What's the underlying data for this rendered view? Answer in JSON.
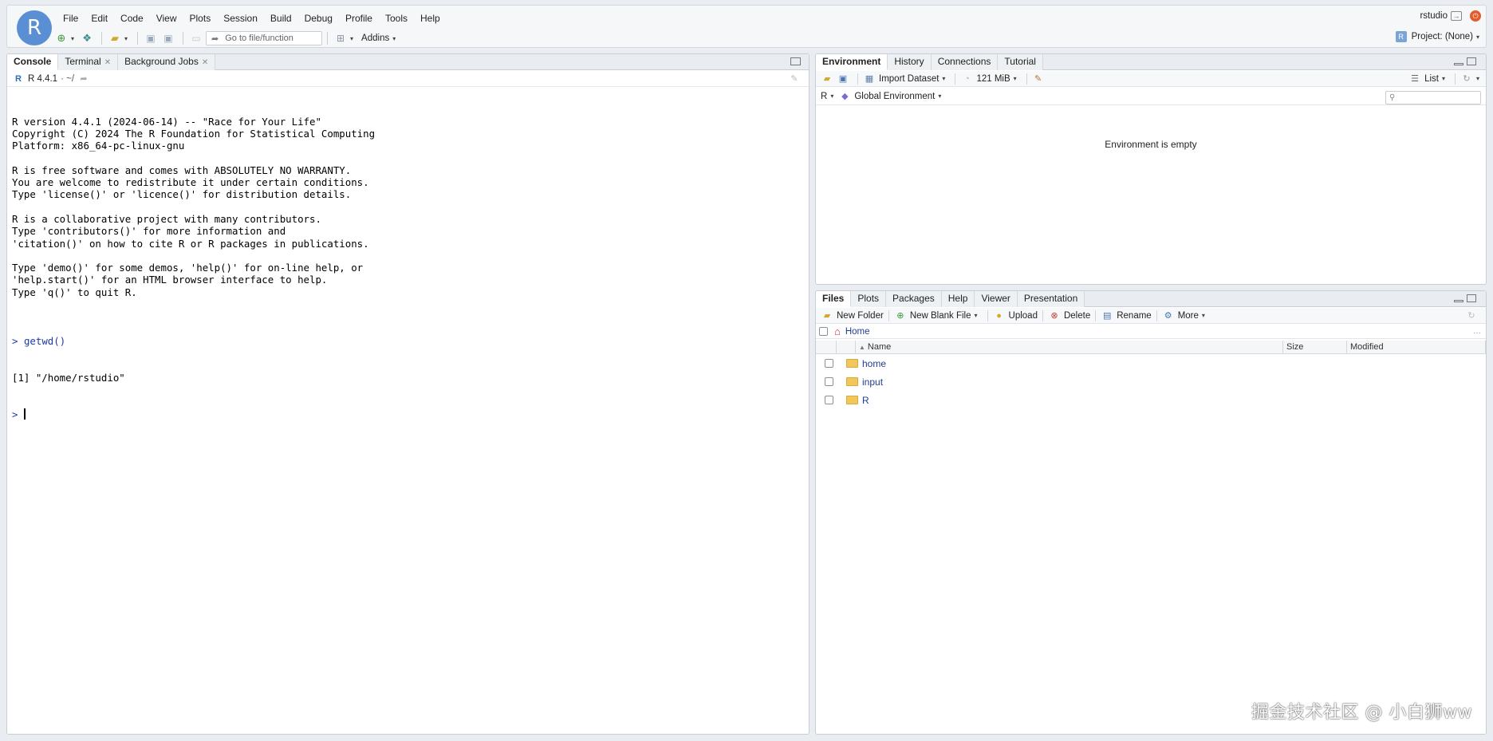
{
  "header": {
    "logo_letter": "R",
    "menu": [
      "File",
      "Edit",
      "Code",
      "View",
      "Plots",
      "Session",
      "Build",
      "Debug",
      "Profile",
      "Tools",
      "Help"
    ],
    "goto_placeholder": "Go to file/function",
    "addins_label": "Addins",
    "user": "rstudio",
    "project_label": "Project: (None)"
  },
  "console_pane": {
    "tabs": [
      {
        "label": "Console",
        "active": true,
        "closable": false
      },
      {
        "label": "Terminal",
        "active": false,
        "closable": true
      },
      {
        "label": "Background Jobs",
        "active": false,
        "closable": true
      }
    ],
    "r_version_label": "R 4.4.1",
    "working_dir": "· ~/",
    "startup_lines": [
      "R version 4.4.1 (2024-06-14) -- \"Race for Your Life\"",
      "Copyright (C) 2024 The R Foundation for Statistical Computing",
      "Platform: x86_64-pc-linux-gnu",
      "",
      "R is free software and comes with ABSOLUTELY NO WARRANTY.",
      "You are welcome to redistribute it under certain conditions.",
      "Type 'license()' or 'licence()' for distribution details.",
      "",
      "R is a collaborative project with many contributors.",
      "Type 'contributors()' for more information and",
      "'citation()' on how to cite R or R packages in publications.",
      "",
      "Type 'demo()' for some demos, 'help()' for on-line help, or",
      "'help.start()' for an HTML browser interface to help.",
      "Type 'q()' to quit R.",
      ""
    ],
    "command_prompt": ">",
    "command": "getwd()",
    "command_output": "[1] \"/home/rstudio\"",
    "input_prompt": ">"
  },
  "env_pane": {
    "tabs": [
      {
        "label": "Environment",
        "active": true
      },
      {
        "label": "History",
        "active": false
      },
      {
        "label": "Connections",
        "active": false
      },
      {
        "label": "Tutorial",
        "active": false
      }
    ],
    "import_dataset_label": "Import Dataset",
    "memory_label": "121 MiB",
    "view_mode_label": "List",
    "language_label": "R",
    "scope_label": "Global Environment",
    "empty_message": "Environment is empty"
  },
  "files_pane": {
    "tabs": [
      {
        "label": "Files",
        "active": true
      },
      {
        "label": "Plots",
        "active": false
      },
      {
        "label": "Packages",
        "active": false
      },
      {
        "label": "Help",
        "active": false
      },
      {
        "label": "Viewer",
        "active": false
      },
      {
        "label": "Presentation",
        "active": false
      }
    ],
    "toolbar": {
      "new_folder": "New Folder",
      "new_blank_file": "New Blank File",
      "upload": "Upload",
      "delete": "Delete",
      "rename": "Rename",
      "more": "More"
    },
    "path_label": "Home",
    "columns": {
      "name": "Name",
      "size": "Size",
      "modified": "Modified"
    },
    "entries": [
      {
        "name": "home",
        "type": "folder"
      },
      {
        "name": "input",
        "type": "folder"
      },
      {
        "name": "R",
        "type": "folder"
      }
    ]
  },
  "watermark": "掘金技术社区 @ 小白狮ww",
  "colors": {
    "logo": "#5b8fd3",
    "link": "#1f3e8f",
    "prompt": "#1a3aa8",
    "folder": "#f1c75b"
  }
}
